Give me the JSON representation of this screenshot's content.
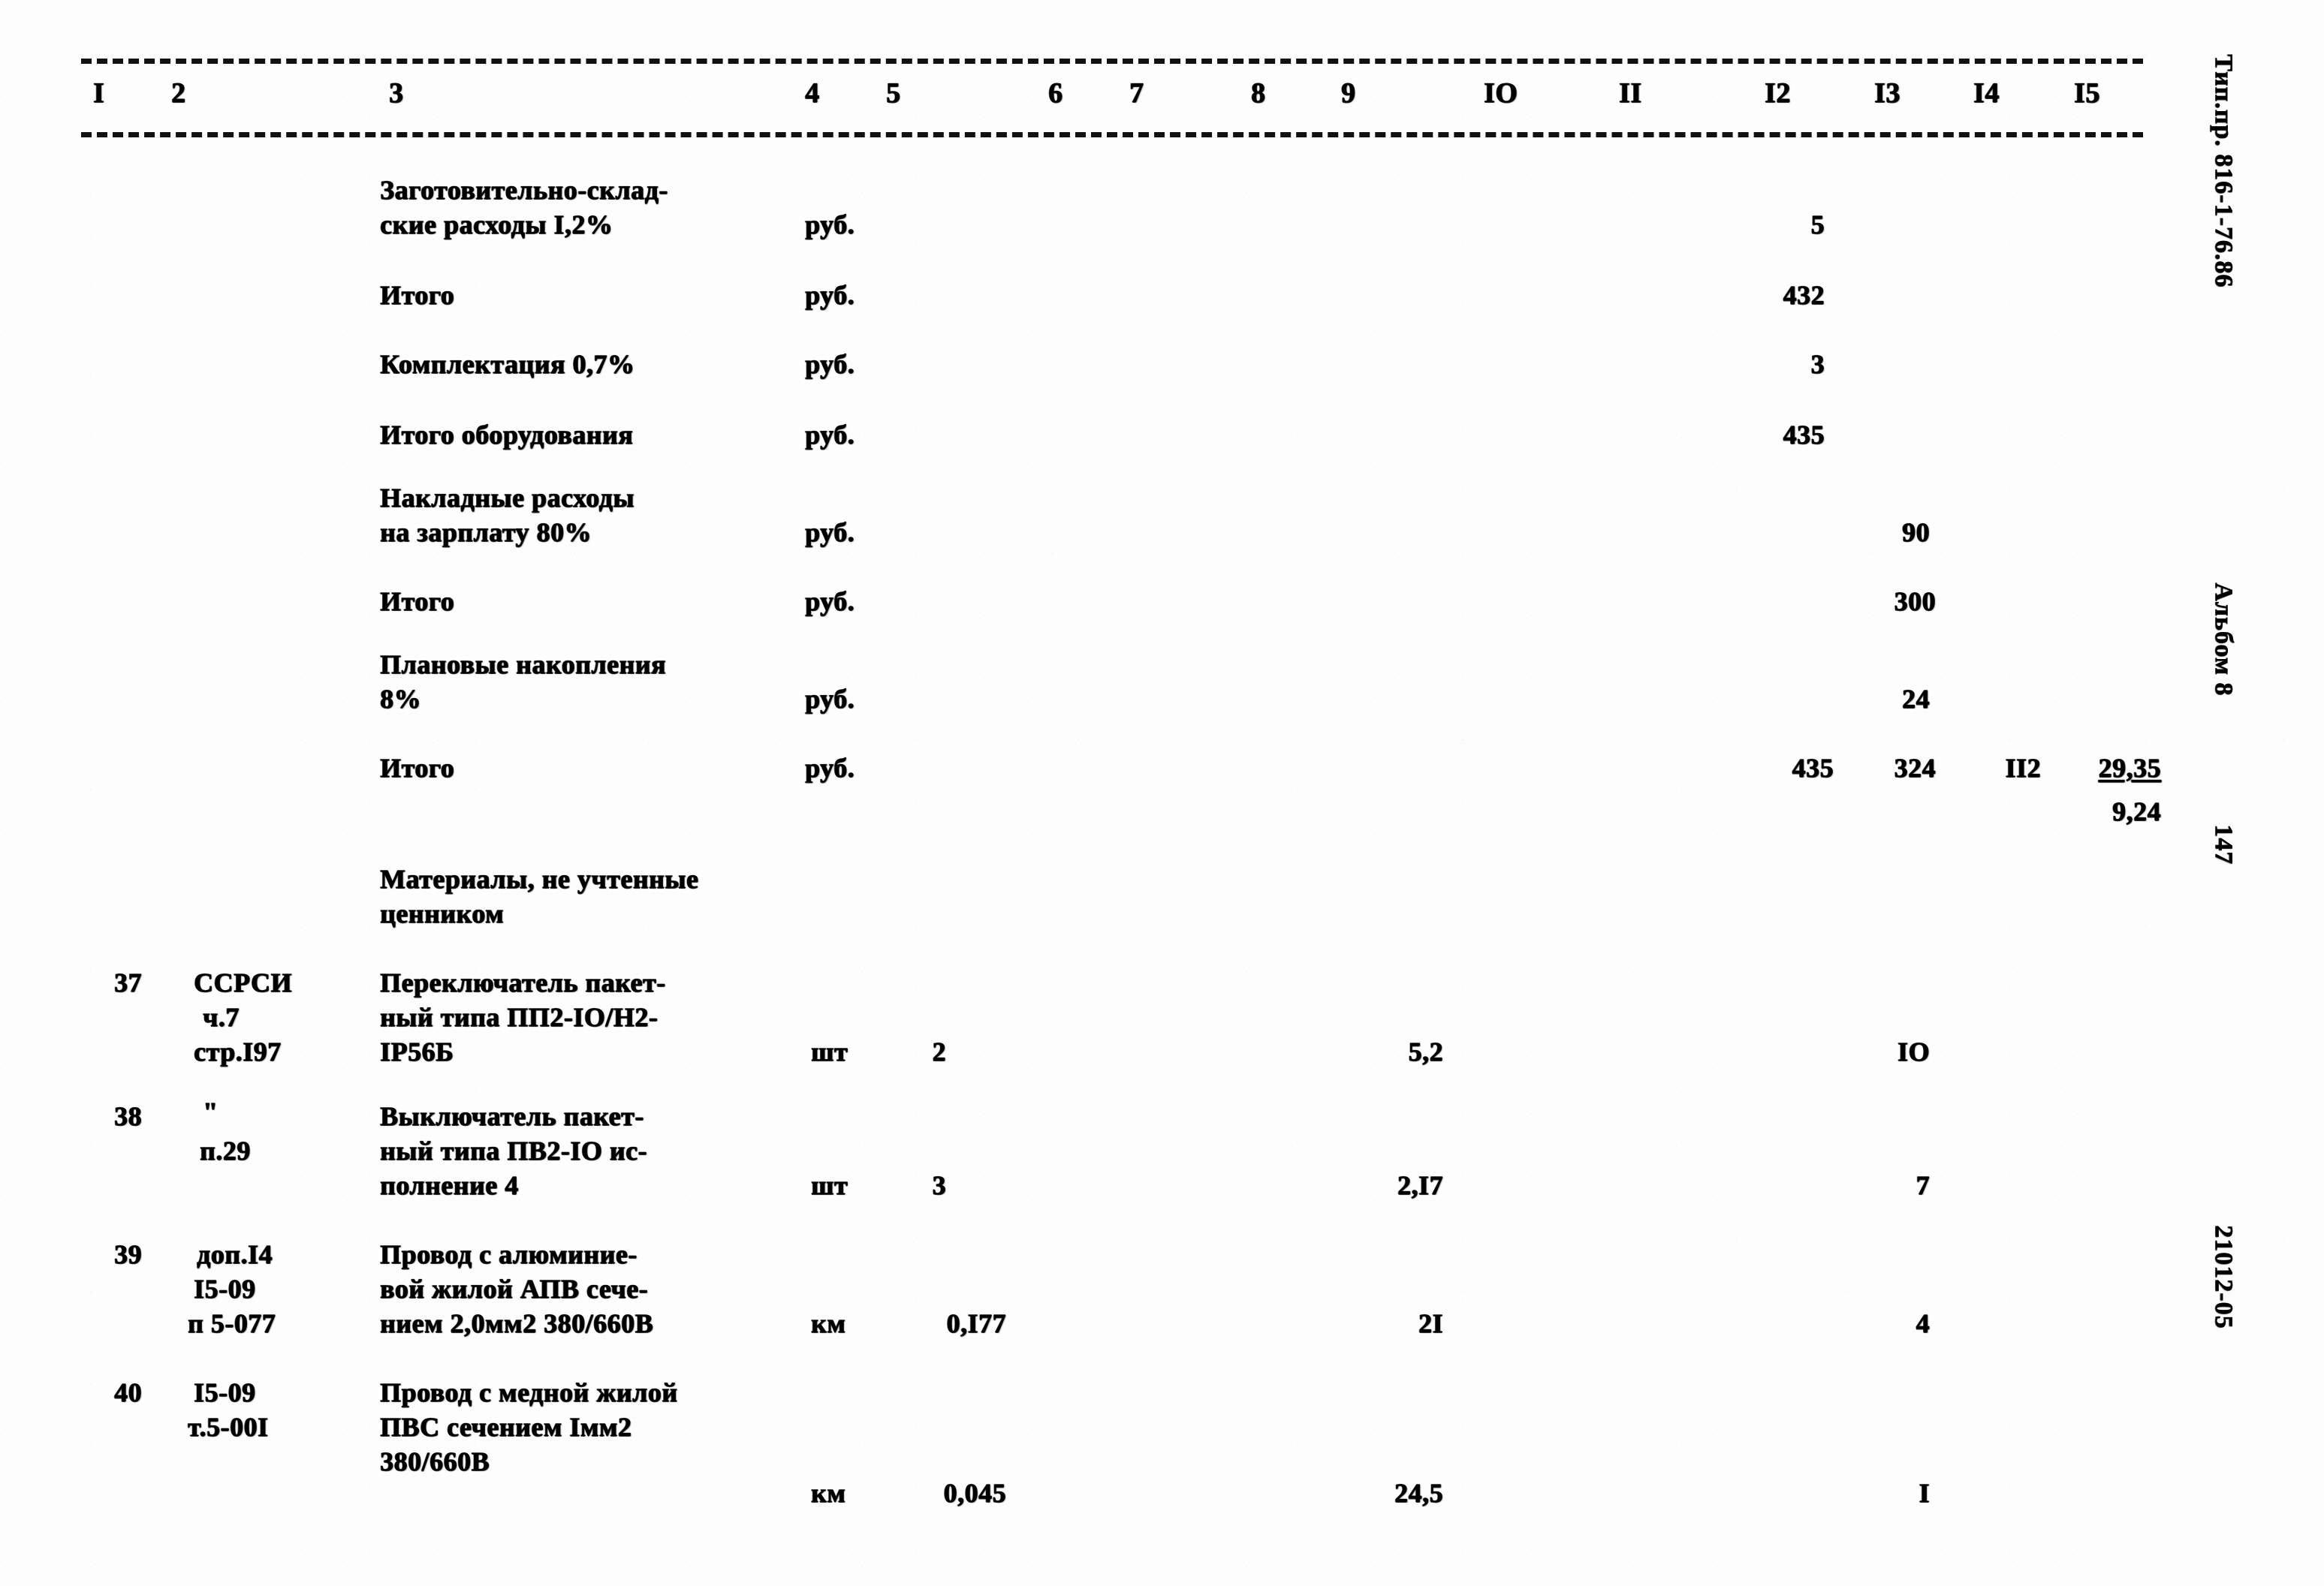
{
  "document": {
    "type_designation": "Тип.пр. 816-1-76.86",
    "album": "Альбом 8",
    "page_number": "147",
    "sheet_code": "21012-05"
  },
  "column_header": {
    "numbers": [
      "I",
      "2",
      "3",
      "4",
      "5",
      "6",
      "7",
      "8",
      "9",
      "IO",
      "II",
      "I2",
      "I3",
      "I4",
      "I5"
    ]
  },
  "summary_rows": [
    {
      "name": "Заготовительно-складские расходы I,2%",
      "desc_line1": "Заготовительно-склад-",
      "desc_line2": "ские расходы I,2%",
      "unit": "руб.",
      "col12": "5",
      "col13": "",
      "col14": "",
      "col15": ""
    },
    {
      "name": "Итого",
      "desc_line1": "Итого",
      "desc_line2": "",
      "unit": "руб.",
      "col12": "432",
      "col13": "",
      "col14": "",
      "col15": ""
    },
    {
      "name": "Комплектация 0,7%",
      "desc_line1": "Комплектация 0,7%",
      "desc_line2": "",
      "unit": "руб.",
      "col12": "3",
      "col13": "",
      "col14": "",
      "col15": ""
    },
    {
      "name": "Итого оборудования",
      "desc_line1": "Итого оборудования",
      "desc_line2": "",
      "unit": "руб.",
      "col12": "435",
      "col13": "",
      "col14": "",
      "col15": ""
    },
    {
      "name": "Накладные расходы на зарплату 80%",
      "desc_line1": "Накладные расходы",
      "desc_line2": "на зарплату 80%",
      "unit": "руб.",
      "col12": "",
      "col13": "90",
      "col14": "",
      "col15": ""
    },
    {
      "name": "Итого",
      "desc_line1": "Итого",
      "desc_line2": "",
      "unit": "руб.",
      "col12": "",
      "col13": "300",
      "col14": "",
      "col15": ""
    },
    {
      "name": "Плановые накопления 8%",
      "desc_line1": "Плановые накопления",
      "desc_line2": "8%",
      "unit": "руб.",
      "col12": "",
      "col13": "24",
      "col14": "",
      "col15": ""
    },
    {
      "name": "Итого",
      "desc_line1": "Итого",
      "desc_line2": "",
      "unit": "руб.",
      "col12": "435",
      "col13": "324",
      "col14": "II2",
      "col15_top": "29,35",
      "col15_bottom": "9,24"
    }
  ],
  "section_heading": {
    "line1": "Материалы, не учтенные",
    "line2": "ценником"
  },
  "item_rows": [
    {
      "no": "37",
      "code_lines": [
        "ССРСИ",
        "ч.7",
        "стр.I97"
      ],
      "desc_lines": [
        "Переключатель пакет-",
        "ный типа ПП2-IO/Н2-",
        "IP56Б"
      ],
      "unit": "шт",
      "qty": "2",
      "col9": "5,2",
      "col13": "IO"
    },
    {
      "no": "38",
      "code_lines": [
        "\"",
        "п.29"
      ],
      "desc_lines": [
        "Выключатель пакет-",
        "ный типа ПВ2-IO ис-",
        "полнение 4"
      ],
      "unit": "шт",
      "qty": "3",
      "col9": "2,I7",
      "col13": "7"
    },
    {
      "no": "39",
      "code_lines": [
        "доп.I4",
        "I5-09",
        "п 5-077"
      ],
      "desc_lines": [
        "Провод с алюминие-",
        "вой жилой АПВ сече-",
        "нием 2,0мм2 380/660В"
      ],
      "unit": "км",
      "qty": "0,I77",
      "col9": "2I",
      "col13": "4"
    },
    {
      "no": "40",
      "code_lines": [
        "I5-09",
        "т.5-00I"
      ],
      "desc_lines": [
        "Провод с медной жилой",
        "ПВС сечением Iмм2",
        "380/660В"
      ],
      "unit": "км",
      "qty": "0,045",
      "col9": "24,5",
      "col13": "I"
    }
  ]
}
